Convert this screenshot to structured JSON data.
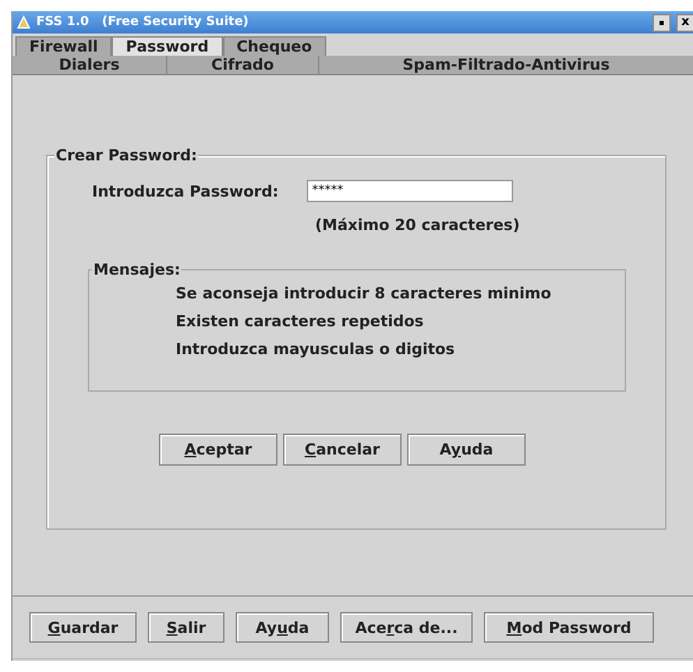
{
  "window": {
    "title": "FSS 1.0   (Free Security Suite)",
    "close": "x"
  },
  "tab_rows": [
    [
      {
        "label": "Firewall",
        "selected": false
      },
      {
        "label": "Password",
        "selected": true
      },
      {
        "label": "Chequeo",
        "selected": false
      }
    ],
    [
      {
        "label": "Dialers",
        "selected": false
      },
      {
        "label": "Cifrado",
        "selected": false
      },
      {
        "label": "Spam-Filtrado-Antivirus",
        "selected": false
      }
    ]
  ],
  "create_group": {
    "title": "Crear Password:",
    "field_label": "Introduzca Password:",
    "value": "*****",
    "hint": "(Máximo 20 caracteres)",
    "messages": {
      "title": "Mensajes:",
      "lines": [
        "Se aconseja introducir 8 caracteres minimo",
        "Existen caracteres repetidos",
        "Introduzca mayusculas o digitos"
      ]
    },
    "buttons": [
      {
        "key": "A",
        "post": "ceptar"
      },
      {
        "key": "C",
        "post": "ancelar"
      },
      {
        "pre": "A",
        "key": "y",
        "post": "uda"
      }
    ]
  },
  "bottom_buttons": [
    {
      "key": "G",
      "post": "uardar"
    },
    {
      "key": "S",
      "post": "alir"
    },
    {
      "pre": "Ay",
      "key": "u",
      "post": "da"
    },
    {
      "pre": "Ace",
      "key": "r",
      "post": "ca de..."
    },
    {
      "key": "M",
      "post": "od Password"
    }
  ]
}
